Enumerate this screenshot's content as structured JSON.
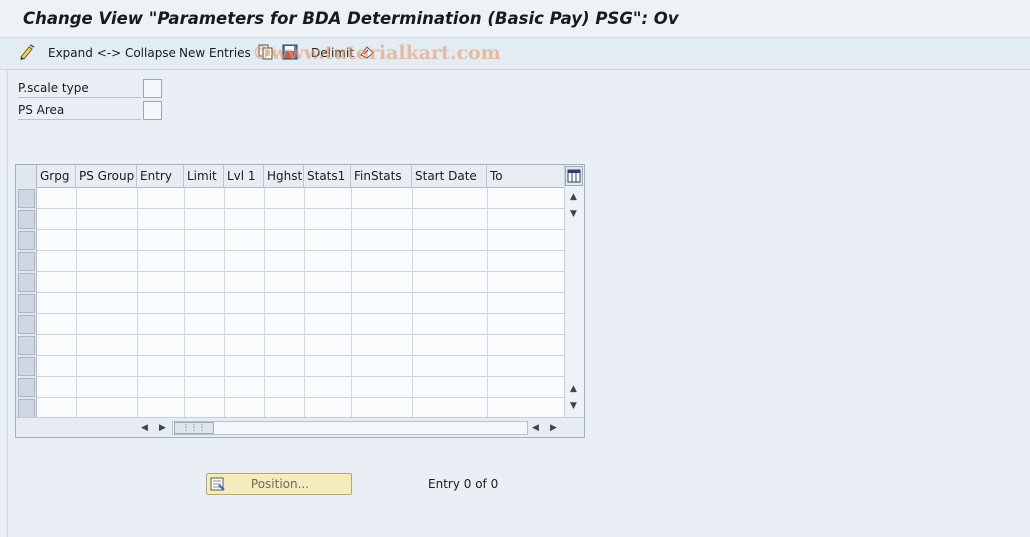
{
  "window": {
    "title": "Change View \"Parameters for BDA Determination (Basic Pay)     PSG\": Ov"
  },
  "toolbar": {
    "expand_collapse_label": "Expand <-> Collapse",
    "new_entries_label": "New Entries",
    "delimit_label": "Delimit",
    "icons": [
      "edit-pen-icon",
      "copy-icon",
      "save-local-icon",
      "delimit-icon"
    ]
  },
  "watermark": "©www.tutorialkart.com",
  "filters": [
    {
      "label": "P.scale type",
      "value": ""
    },
    {
      "label": "PS Area",
      "value": ""
    }
  ],
  "table": {
    "columns": [
      "Grpg",
      "PS Group",
      "Entry",
      "Limit",
      "Lvl 1",
      "Hghst",
      "Stats1",
      "FinStats",
      "Start Date",
      "To"
    ],
    "rows": [],
    "empty_row_count": 11
  },
  "footer": {
    "position_button_label": "Position...",
    "entry_text": "Entry 0 of 0"
  },
  "colors": {
    "background": "#e9eef4",
    "toolbar": "#e3ebf3",
    "position_button": "#f5ecbd"
  }
}
